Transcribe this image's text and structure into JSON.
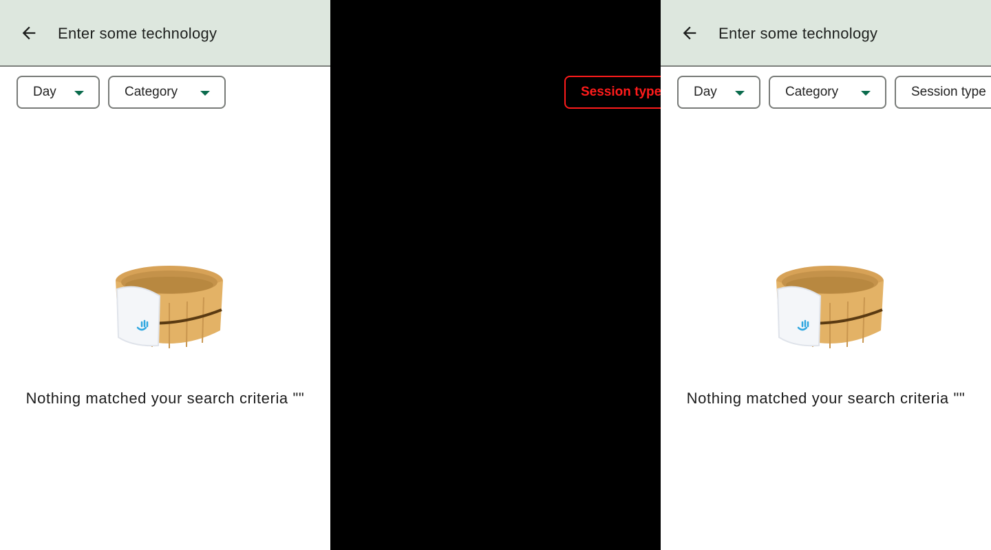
{
  "left": {
    "search_text": "Enter some technology",
    "chips": {
      "day": "Day",
      "category": "Category"
    },
    "empty_message": "Nothing matched your search criteria \"\""
  },
  "middle": {
    "ghost_chip": "Session type"
  },
  "right": {
    "search_text": "Enter some technology",
    "chips": {
      "day": "Day",
      "category": "Category",
      "session_type": "Session type"
    },
    "empty_message": "Nothing matched your search criteria \"\""
  },
  "colors": {
    "appbar_bg": "#dde7de",
    "caret": "#0a6b4c",
    "ghost_outline": "#ff1b1b"
  },
  "icons": {
    "back": "arrow-back-icon",
    "dropdown": "chevron-down-icon",
    "empty": "wooden-bath-bucket-illustration"
  }
}
